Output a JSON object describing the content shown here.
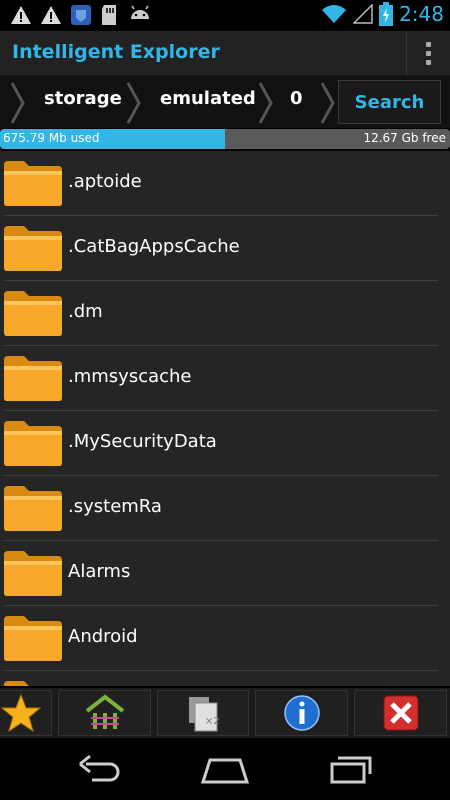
{
  "status_bar": {
    "time": "2:48",
    "icons": [
      "warning-icon",
      "warning-icon",
      "app-icon",
      "sd-card-icon",
      "android-icon",
      "wifi-icon",
      "signal-icon",
      "battery-charging-icon"
    ],
    "accent": "#33b5e5"
  },
  "action_bar": {
    "title": "Intelligent Explorer",
    "overflow_icon": "overflow-menu-icon"
  },
  "breadcrumb": {
    "items": [
      "storage",
      "emulated",
      "0"
    ],
    "search_label": "Search"
  },
  "storage": {
    "used_label": "675.79 Mb used",
    "free_label": "12.67 Gb free",
    "used_fraction": 0.5
  },
  "files": [
    {
      "name": ".aptoide",
      "icon": "folder-icon"
    },
    {
      "name": ".CatBagAppsCache",
      "icon": "folder-icon"
    },
    {
      "name": ".dm",
      "icon": "folder-icon"
    },
    {
      "name": ".mmsyscache",
      "icon": "folder-icon"
    },
    {
      "name": ".MySecurityData",
      "icon": "folder-icon"
    },
    {
      "name": ".systemRa",
      "icon": "folder-icon"
    },
    {
      "name": "Alarms",
      "icon": "folder-icon"
    },
    {
      "name": "Android",
      "icon": "folder-icon"
    }
  ],
  "toolbar": {
    "buttons": [
      "favorites-star-icon",
      "home-network-icon",
      "copy-x2-icon",
      "info-icon",
      "close-red-icon"
    ]
  },
  "nav_bar": {
    "buttons": [
      "back-icon",
      "home-icon",
      "recents-icon"
    ]
  },
  "colors": {
    "accent": "#33b5e5",
    "folder": "#f5a623",
    "list_bg": "#252525",
    "close_red": "#d32f2f"
  }
}
